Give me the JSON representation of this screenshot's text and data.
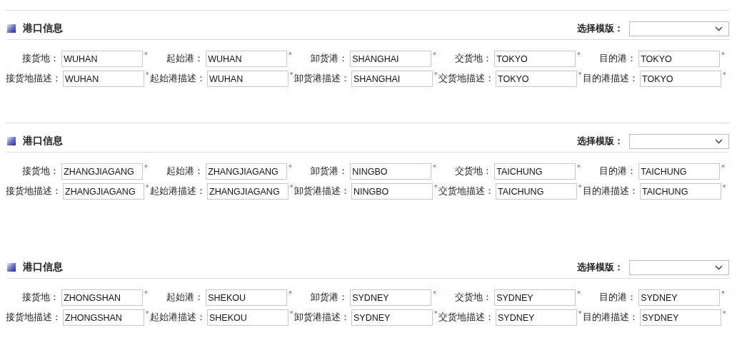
{
  "sections": [
    {
      "title": "港口信息",
      "template_label": "选择模版：",
      "rows": [
        [
          {
            "label": "接货地：",
            "value": "WUHAN",
            "mark": "*"
          },
          {
            "label": "起始港：",
            "value": "WUHAN",
            "mark": "*"
          },
          {
            "label": "卸货港：",
            "value": "SHANGHAI",
            "mark": "*"
          },
          {
            "label": "交货地：",
            "value": "TOKYO",
            "mark": "*"
          },
          {
            "label": "目的港：",
            "value": "TOKYO",
            "mark": "*"
          }
        ],
        [
          {
            "label": "接货地描述：",
            "value": "WUHAN",
            "mark": "*"
          },
          {
            "label": "起始港描述：",
            "value": "WUHAN",
            "mark": "*"
          },
          {
            "label": "卸货港描述：",
            "value": "SHANGHAI",
            "mark": "*"
          },
          {
            "label": "交货地描述：",
            "value": "TOKYO",
            "mark": "*"
          },
          {
            "label": "目的港描述：",
            "value": "TOKYO",
            "mark": "*"
          }
        ]
      ]
    },
    {
      "title": "港口信息",
      "template_label": "选择模版：",
      "rows": [
        [
          {
            "label": "接货地：",
            "value": "ZHANGJIAGANG",
            "mark": "*"
          },
          {
            "label": "起始港：",
            "value": "ZHANGJIAGANG",
            "mark": "*"
          },
          {
            "label": "卸货港：",
            "value": "NINGBO",
            "mark": "*"
          },
          {
            "label": "交货地：",
            "value": "TAICHUNG",
            "mark": "*"
          },
          {
            "label": "目的港：",
            "value": "TAICHUNG",
            "mark": "*"
          }
        ],
        [
          {
            "label": "接货地描述：",
            "value": "ZHANGJIAGANG",
            "mark": "*"
          },
          {
            "label": "起始港描述：",
            "value": "ZHANGJIAGANG",
            "mark": "*"
          },
          {
            "label": "卸货港描述：",
            "value": "NINGBO",
            "mark": "*"
          },
          {
            "label": "交货地描述：",
            "value": "TAICHUNG",
            "mark": "*"
          },
          {
            "label": "目的港描述：",
            "value": "TAICHUNG",
            "mark": "*"
          }
        ]
      ]
    },
    {
      "title": "港口信息",
      "template_label": "选择模版：",
      "rows": [
        [
          {
            "label": "接货地：",
            "value": "ZHONGSHAN",
            "mark": "*"
          },
          {
            "label": "起始港：",
            "value": "SHEKOU",
            "mark": "*"
          },
          {
            "label": "卸货港：",
            "value": "SYDNEY",
            "mark": "*"
          },
          {
            "label": "交货地：",
            "value": "SYDNEY",
            "mark": "*"
          },
          {
            "label": "目的港：",
            "value": "SYDNEY",
            "mark": "*"
          }
        ],
        [
          {
            "label": "接货地描述：",
            "value": "ZHONGSHAN",
            "mark": "*"
          },
          {
            "label": "起始港描述：",
            "value": "SHEKOU",
            "mark": "*"
          },
          {
            "label": "卸货港描述：",
            "value": "SYDNEY",
            "mark": "*"
          },
          {
            "label": "交货地描述：",
            "value": "SYDNEY",
            "mark": "*"
          },
          {
            "label": "目的港描述：",
            "value": "SYDNEY",
            "mark": "*"
          }
        ]
      ]
    }
  ]
}
